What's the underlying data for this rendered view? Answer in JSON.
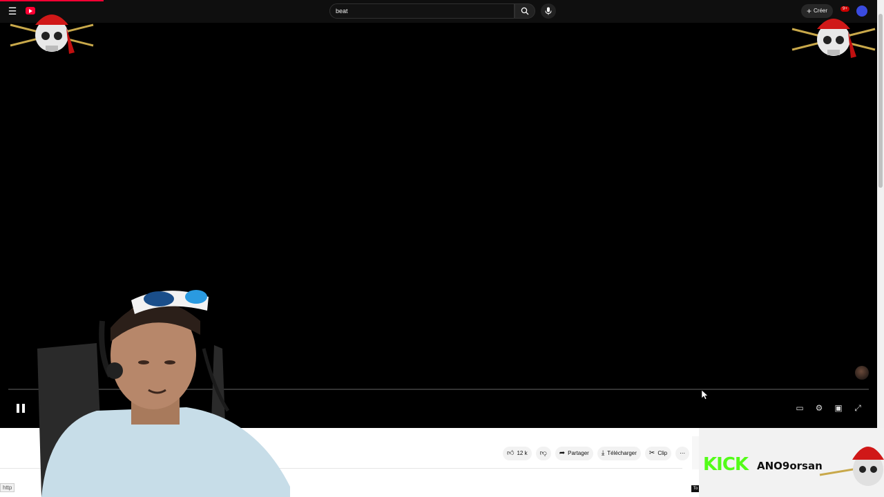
{
  "header": {
    "search_query": "beat",
    "create_label": "Créer",
    "notification_count": "9+"
  },
  "video_actions": {
    "like_count": "12 k",
    "share_label": "Partager",
    "download_label": "Télécharger",
    "clip_label": "Clip",
    "more_label": "⋯"
  },
  "status_bar": {
    "url_prefix": "http"
  },
  "stream_overlay": {
    "kick_logo": "KICK",
    "kick_username": "ANO9orsan"
  },
  "colors": {
    "youtube_red": "#ff0033",
    "kick_green": "#53fc18",
    "player_bg": "#000000",
    "topbar_bg": "#0f0f0f"
  },
  "icons": [
    "menu-icon",
    "youtube-logo-icon",
    "search-icon",
    "microphone-icon",
    "plus-icon",
    "bell-icon",
    "pause-icon",
    "miniplayer-icon",
    "settings-gear-icon",
    "theater-mode-icon",
    "fullscreen-icon",
    "like-icon",
    "dislike-icon",
    "share-icon",
    "download-icon",
    "scissors-icon",
    "more-icon",
    "pirate-skull-icon"
  ]
}
